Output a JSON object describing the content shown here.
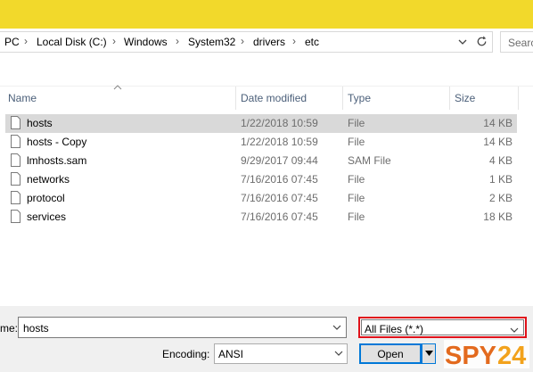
{
  "breadcrumb": {
    "items": [
      "PC",
      "Local Disk (C:)",
      "Windows",
      "System32",
      "drivers",
      "etc"
    ],
    "separator": "›"
  },
  "search": {
    "placeholder": "Searc"
  },
  "columns": {
    "name": "Name",
    "date": "Date modified",
    "type": "Type",
    "size": "Size"
  },
  "files": [
    {
      "name": "hosts",
      "date": "1/22/2018 10:59",
      "type": "File",
      "size": "14 KB",
      "selected": true
    },
    {
      "name": "hosts - Copy",
      "date": "1/22/2018 10:59",
      "type": "File",
      "size": "14 KB",
      "selected": false
    },
    {
      "name": "lmhosts.sam",
      "date": "9/29/2017 09:44",
      "type": "SAM File",
      "size": "4 KB",
      "selected": false
    },
    {
      "name": "networks",
      "date": "7/16/2016 07:45",
      "type": "File",
      "size": "1 KB",
      "selected": false
    },
    {
      "name": "protocol",
      "date": "7/16/2016 07:45",
      "type": "File",
      "size": "2 KB",
      "selected": false
    },
    {
      "name": "services",
      "date": "7/16/2016 07:45",
      "type": "File",
      "size": "18 KB",
      "selected": false
    }
  ],
  "filename": {
    "label": "me:",
    "value": "hosts"
  },
  "filter": {
    "value": "All Files  (*.*)"
  },
  "encoding": {
    "label": "Encoding:",
    "value": "ANSI"
  },
  "open_button": {
    "label": "Open"
  },
  "watermark": {
    "text": "SPY24"
  },
  "colors": {
    "topband": "#f2d92b",
    "selection": "#d9d9d9",
    "filter_highlight": "#e0121a",
    "accent": "#0078d7"
  }
}
